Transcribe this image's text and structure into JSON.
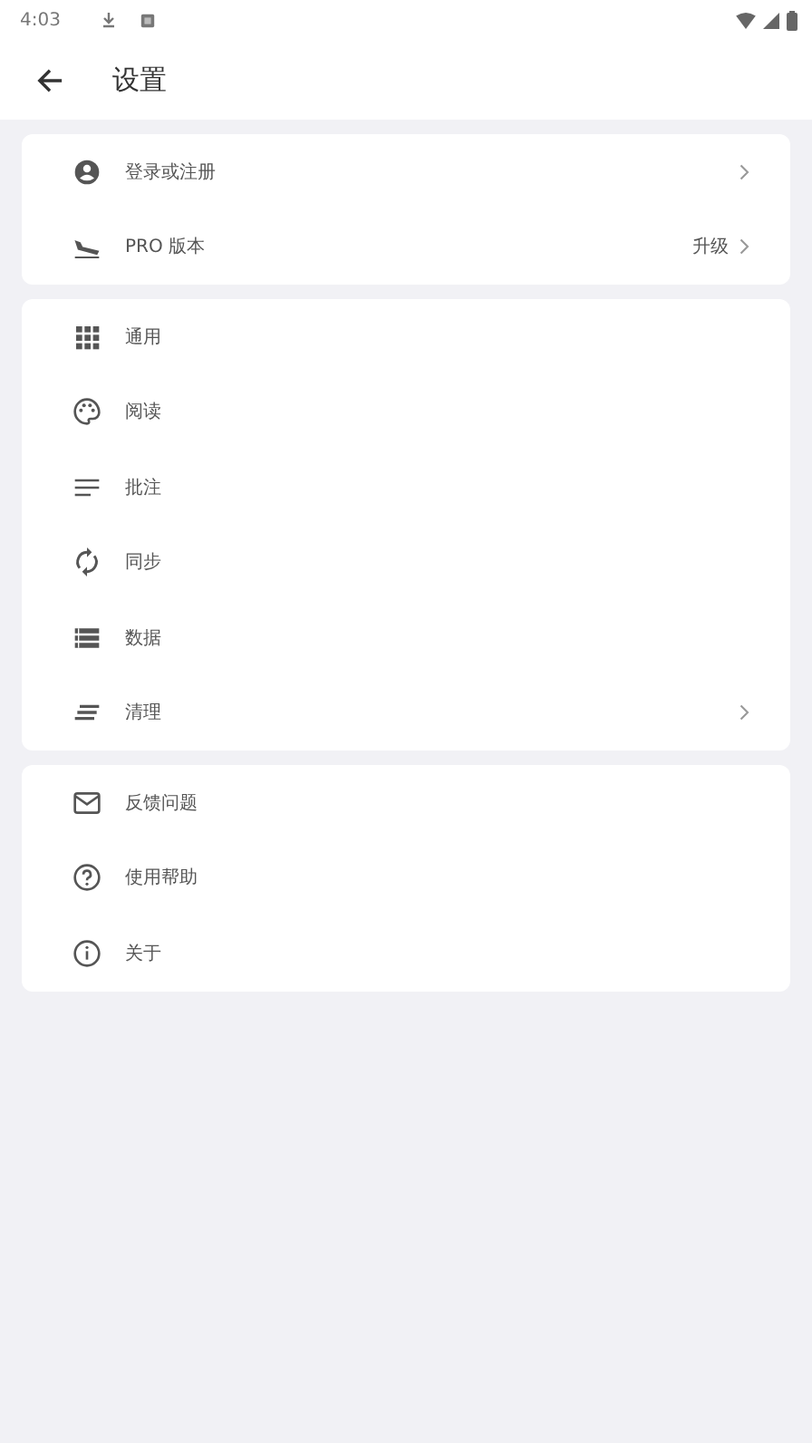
{
  "status_bar": {
    "time": "4:03"
  },
  "header": {
    "title": "设置"
  },
  "groups": [
    {
      "items": [
        {
          "kind": "account",
          "label": "登录或注册",
          "chevron": true
        },
        {
          "kind": "plane",
          "label": "PRO 版本",
          "trailing": "升级",
          "chevron": true
        }
      ]
    },
    {
      "items": [
        {
          "kind": "grid",
          "label": "通用",
          "chevron": false
        },
        {
          "kind": "palette",
          "label": "阅读",
          "chevron": false
        },
        {
          "kind": "notes",
          "label": "批注",
          "chevron": false
        },
        {
          "kind": "sync",
          "label": "同步",
          "chevron": false
        },
        {
          "kind": "list",
          "label": "数据",
          "chevron": false
        },
        {
          "kind": "sweep",
          "label": "清理",
          "chevron": true
        }
      ]
    },
    {
      "items": [
        {
          "kind": "mail",
          "label": "反馈问题",
          "chevron": false
        },
        {
          "kind": "help",
          "label": "使用帮助",
          "chevron": false
        },
        {
          "kind": "info",
          "label": "关于",
          "chevron": false
        }
      ]
    }
  ]
}
